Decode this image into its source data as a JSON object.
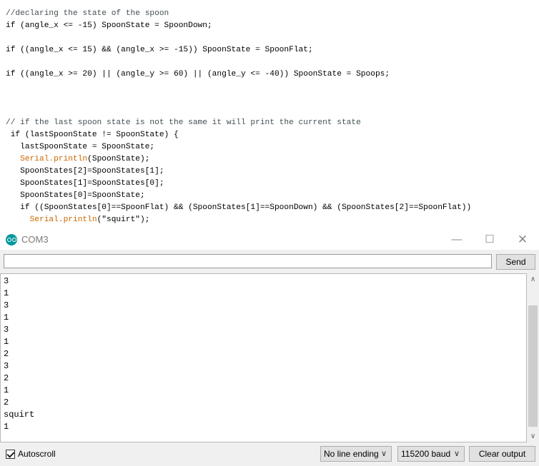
{
  "code": {
    "lines": [
      "//declaring the state of the spoon",
      "if (angle_x <= -15) SpoonState = SpoonDown;",
      "",
      "if ((angle_x <= 15) && (angle_x >= -15)) SpoonState = SpoonFlat;",
      "",
      "if ((angle_x >= 20) || (angle_y >= 60) || (angle_y <= -40)) SpoonState = Spoops;",
      "",
      "",
      "",
      "// if the last spoon state is not the same it will print the current state",
      " if (lastSpoonState != SpoonState) {",
      "   lastSpoonState = SpoonState;",
      "   ",
      "   SpoonStates[2]=SpoonStates[1];",
      "   SpoonStates[1]=SpoonStates[0];",
      "   SpoonStates[0]=SpoonState;",
      "   if ((SpoonStates[0]==SpoonFlat) && (SpoonStates[1]==SpoonDown) && (SpoonStates[2]==SpoonFlat))",
      "     "
    ],
    "println1_kw": "Serial.println",
    "println1_rest": "(SpoonState);",
    "println2_kw": "Serial.println",
    "println2_rest": "(\"squirt\");"
  },
  "serial_monitor": {
    "title": "COM3",
    "send_label": "Send",
    "input_value": "",
    "output_lines": [
      "3",
      "1",
      "3",
      "1",
      "3",
      "1",
      "2",
      "3",
      "2",
      "1",
      "2",
      "squirt",
      "1"
    ],
    "autoscroll_label": "Autoscroll",
    "autoscroll_checked": true,
    "line_ending": "No line ending",
    "baud_rate": "115200 baud",
    "clear_label": "Clear output",
    "icons": {
      "app": "arduino-icon",
      "minimize": "minimize-icon",
      "maximize": "maximize-icon",
      "close": "close-icon"
    }
  },
  "colors": {
    "keyword": "#cc6600",
    "comment": "#434f54",
    "arduino_teal": "#00979c"
  }
}
